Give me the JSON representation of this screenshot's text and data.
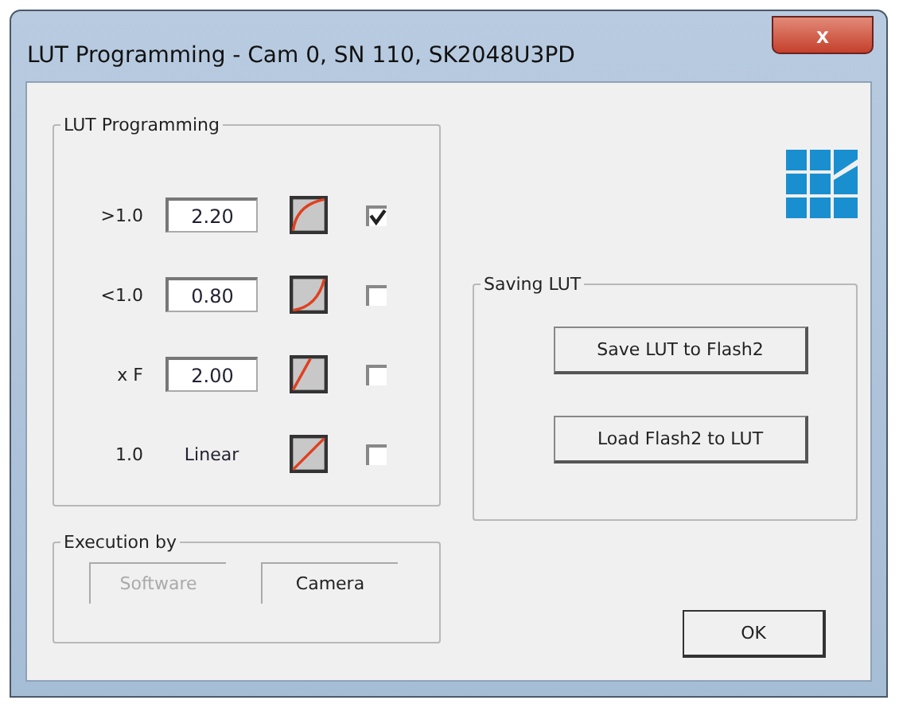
{
  "window": {
    "title": "LUT Programming - Cam 0, SN 110, SK2048U3PD",
    "close": "x"
  },
  "lut_programming": {
    "title": "LUT Programming",
    "rows": [
      {
        "kind": "field",
        "label": ">1.0",
        "value": "2.20",
        "checked": true
      },
      {
        "kind": "field",
        "label": "<1.0",
        "value": "0.80",
        "checked": false
      },
      {
        "kind": "field",
        "label": "x F",
        "value": "2.00",
        "checked": false
      },
      {
        "kind": "text",
        "label": "1.0",
        "value": "Linear",
        "checked": false
      }
    ]
  },
  "execution_by": {
    "title": "Execution by",
    "options": [
      {
        "label": "Software",
        "disabled": true
      },
      {
        "label": "Camera",
        "disabled": false
      }
    ]
  },
  "saving_lut": {
    "title": "Saving LUT",
    "buttons": [
      "Save LUT to Flash2",
      "Load Flash2 to LUT"
    ]
  },
  "buttons": [
    "OK"
  ]
}
